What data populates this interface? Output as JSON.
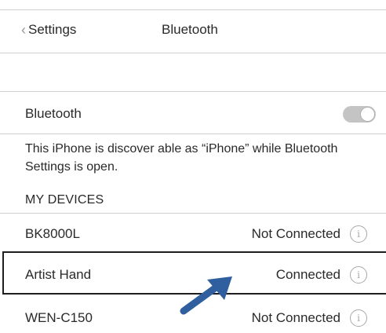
{
  "nav": {
    "back_label": "Settings",
    "title": "Bluetooth"
  },
  "bluetooth_row": {
    "label": "Bluetooth",
    "toggle_on": false
  },
  "description": "This iPhone is discover able as “iPhone” while Bluetooth Settings is open.",
  "section_header": "MY DEVICES",
  "devices": [
    {
      "name": "BK8000L",
      "status": "Not Connected"
    },
    {
      "name": "Artist Hand",
      "status": "Connected"
    },
    {
      "name": "WEN-C150",
      "status": "Not Connected"
    }
  ],
  "info_glyph": "i",
  "colors": {
    "toggle_off": "#c4c4c4",
    "arrow": "#2f5f9e",
    "highlight_border": "#1e1e1e"
  },
  "icons": {
    "back": "chevron-left-icon",
    "info": "info-circle-icon",
    "pointer": "arrow-annotation"
  }
}
